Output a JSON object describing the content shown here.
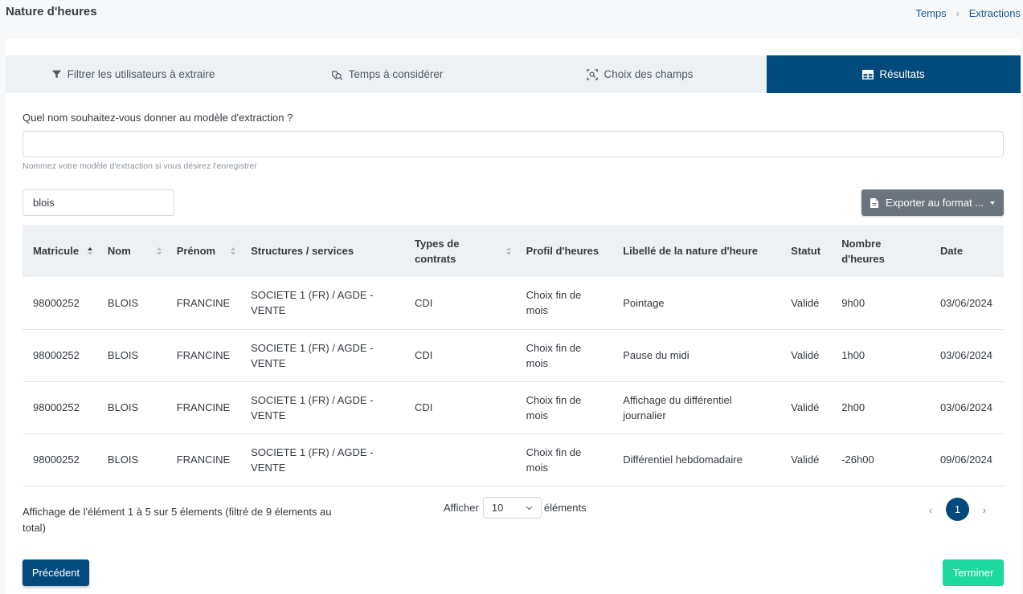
{
  "header": {
    "title": "Nature d'heures",
    "breadcrumb": [
      "Temps",
      "Extractions"
    ]
  },
  "tabs": [
    {
      "label": "Filtrer les utilisateurs à extraire",
      "icon": "filter-icon"
    },
    {
      "label": "Temps à considérer",
      "icon": "time-search-icon"
    },
    {
      "label": "Choix des champs",
      "icon": "field-search-icon"
    },
    {
      "label": "Résultats",
      "icon": "table-icon",
      "active": true
    }
  ],
  "form": {
    "question": "Quel nom souhaitez-vous donner au modèle d'extraction ?",
    "name_value": "",
    "help": "Nommez votre modèle d'extraction si vous désirez l'enregistrer"
  },
  "search": {
    "value": "blois"
  },
  "export": {
    "label": "Exporter au format ..."
  },
  "table": {
    "columns": [
      "Matricule",
      "Nom",
      "Prénom",
      "Structures / services",
      "Types de contrats",
      "Profil d'heures",
      "Libellé de la nature d'heure",
      "Statut",
      "Nombre d'heures",
      "Date"
    ],
    "rows": [
      [
        "98000252",
        "BLOIS",
        "FRANCINE",
        "SOCIETE 1 (FR) / AGDE - VENTE",
        "CDI",
        "Choix fin de mois",
        "Pointage",
        "Validé",
        "9h00",
        "03/06/2024"
      ],
      [
        "98000252",
        "BLOIS",
        "FRANCINE",
        "SOCIETE 1 (FR) / AGDE - VENTE",
        "CDI",
        "Choix fin de mois",
        "Pause du midi",
        "Validé",
        "1h00",
        "03/06/2024"
      ],
      [
        "98000252",
        "BLOIS",
        "FRANCINE",
        "SOCIETE 1 (FR) / AGDE - VENTE",
        "CDI",
        "Choix fin de mois",
        "Affichage du différentiel journalier",
        "Validé",
        "2h00",
        "03/06/2024"
      ],
      [
        "98000252",
        "BLOIS",
        "FRANCINE",
        "SOCIETE 1 (FR) / AGDE - VENTE",
        "",
        "Choix fin de mois",
        "Différentiel hebdomadaire",
        "Validé",
        "-26h00",
        "09/06/2024"
      ]
    ]
  },
  "footer": {
    "info": "Affichage de l'élément 1 à 5 sur 5 élements (filtré de 9 élements au total)",
    "show_label": "Afficher",
    "page_size": "10",
    "elements_label": "éléments",
    "prev_arrow": "‹",
    "next_arrow": "›",
    "current_page": "1"
  },
  "buttons": {
    "previous": "Précédent",
    "finish": "Terminer"
  },
  "colors": {
    "primary": "#004b7c",
    "success": "#1dd89f",
    "secondary": "#6c757d"
  }
}
